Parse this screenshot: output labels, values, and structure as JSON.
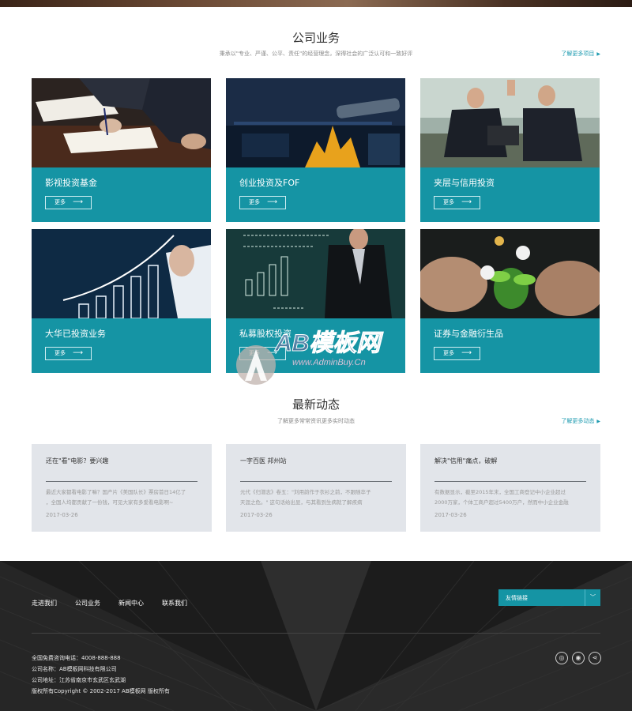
{
  "business": {
    "title": "公司业务",
    "subtitle": "秉承以\"专业、严谨、公平、责任\"的经营理念，深得社会的广泛认可和一致好评",
    "more": "了解更多项目"
  },
  "cards": [
    {
      "title": "影视投资基金",
      "btn": "更多"
    },
    {
      "title": "创业投资及FOF",
      "btn": "更多"
    },
    {
      "title": "夹层与信用投资",
      "btn": "更多"
    },
    {
      "title": "大华已投资业务",
      "btn": "更多"
    },
    {
      "title": "私募股权投资",
      "btn": "更多"
    },
    {
      "title": "证券与金融衍生品",
      "btn": "更多"
    }
  ],
  "news": {
    "title": "最新动态",
    "subtitle": "了解更多常常资讯更多实时动态",
    "more": "了解更多动态",
    "items": [
      {
        "title": "还在\"看\"电影？要兴趣",
        "body1": "最近大家都看电影了嘛？国产片《美国队长》票房首日14亿了",
        "body2": "，全国人均都贡献了一份钱，可见大家有多爱看电影啊~",
        "date": "2017-03-26"
      },
      {
        "title": "一字百医 邦州站",
        "body1": "元代《归潜志》卷五：\"刘用韵作于衣衫之前，不跟随卒子",
        "body2": "天涯之危。\" 这句话给出显，与其看到生病就了解疾病",
        "date": "2017-03-26"
      },
      {
        "title": "解决\"信用\"痛点，破解",
        "body1": "有数据显示，截至2015年末，全国工商登记中小企业超过",
        "body2": "2000万家，个体工商户超过5400万户，然而中小企业金融",
        "date": "2017-03-26"
      }
    ]
  },
  "footer": {
    "nav": [
      "走进我们",
      "公司业务",
      "新闻中心",
      "联系我们"
    ],
    "select_label": "友情链接",
    "hotline": "全国免费咨询电话：4008-888-888",
    "company": "公司名称：AB模板网科技有限公司",
    "address": "公司地址：江苏省南京市玄武区玄武湖",
    "copyright": "版权所有Copyright © 2002-2017 AB模板网 版权所有"
  },
  "watermark": {
    "text": "AB模板网",
    "sub": "www.AdminBuy.Cn"
  },
  "colors": {
    "accent": "#1594a4",
    "footer_bg": "#1b1b1b",
    "news_bg": "#e2e5ea"
  }
}
